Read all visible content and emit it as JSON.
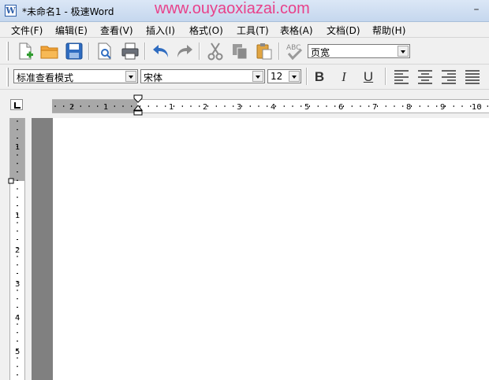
{
  "window": {
    "title": "*未命名1 - 极速Word",
    "icon": "word-app-icon",
    "minimize_glyph": "–",
    "watermark": "www.ouyaoxiazai.com"
  },
  "menu": [
    {
      "label": "文件(F)"
    },
    {
      "label": "编辑(E)"
    },
    {
      "label": "查看(V)"
    },
    {
      "label": "插入(I)"
    },
    {
      "label": "格式(O)"
    },
    {
      "label": "工具(T)"
    },
    {
      "label": "表格(A)"
    },
    {
      "label": "文档(D)"
    },
    {
      "label": "帮助(H)"
    }
  ],
  "toolbar": {
    "buttons": [
      "new-document-icon",
      "open-folder-icon",
      "save-icon",
      "print-preview-icon",
      "print-icon",
      "undo-icon",
      "redo-icon",
      "cut-icon",
      "copy-icon",
      "paste-icon",
      "spellcheck-icon"
    ],
    "spellcheck_label": "ABC",
    "zoom_value": "页宽"
  },
  "format": {
    "style_value": "标准查看模式",
    "font_value": "宋体",
    "size_value": "12",
    "bold": "B",
    "italic": "I",
    "underline": "U",
    "colors": {
      "accent": "#2d5ea8",
      "ruler_gray": "#a8a8a8"
    }
  },
  "ruler": {
    "h_labels": [
      "2",
      "1",
      "1",
      "2",
      "3",
      "4",
      "5",
      "6",
      "7",
      "8",
      "9",
      "10"
    ],
    "v_labels": [
      "1",
      "1",
      "2",
      "3",
      "4",
      "5"
    ]
  }
}
